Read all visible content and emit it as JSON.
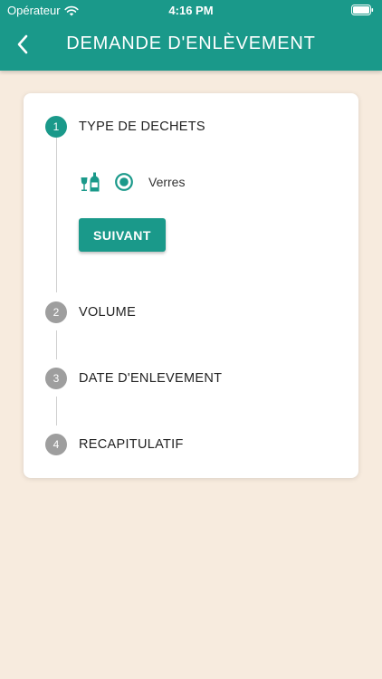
{
  "status_bar": {
    "carrier": "Opérateur",
    "time": "4:16 PM"
  },
  "header": {
    "title": "DEMANDE D'ENLÈVEMENT",
    "back_icon": "chevron-left-icon"
  },
  "steps": [
    {
      "number": "1",
      "label": "TYPE DE DECHETS",
      "active": true
    },
    {
      "number": "2",
      "label": "VOLUME",
      "active": false
    },
    {
      "number": "3",
      "label": "DATE D'ENLEVEMENT",
      "active": false
    },
    {
      "number": "4",
      "label": "RECAPITULATIF",
      "active": false
    }
  ],
  "waste_option": {
    "label": "Verres",
    "selected": true,
    "icon": "bottles-icon"
  },
  "next_button": {
    "label": "SUIVANT"
  },
  "colors": {
    "primary": "#1a998a",
    "background": "#f7ebde",
    "inactive_step": "#9e9e9e"
  }
}
